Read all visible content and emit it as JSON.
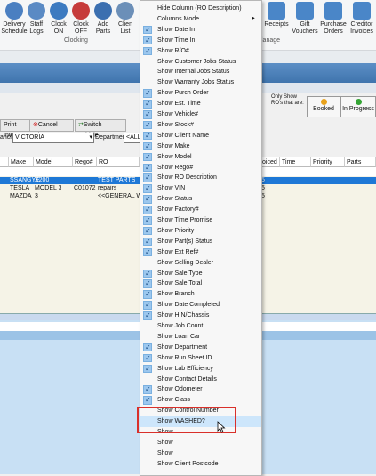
{
  "ribbon": {
    "buttons": [
      {
        "label": "Delivery\nSchedule",
        "icon": "calendar-icon",
        "color": "#4a7fc1"
      },
      {
        "label": "Staff\nLogs",
        "icon": "staff-logs-icon",
        "color": "#5a8ac4"
      },
      {
        "label": "Clock\nON",
        "icon": "clock-on-icon",
        "color": "#3c7ac0"
      },
      {
        "label": "Clock\nOFF",
        "icon": "clock-off-icon",
        "color": "#c63b3b"
      },
      {
        "label": "Add\nParts",
        "icon": "gear-add-icon",
        "color": "#3b6fb0"
      },
      {
        "label": "Clien\nList",
        "icon": "client-list-icon",
        "color": "#6b8fb8"
      }
    ],
    "right_buttons": [
      {
        "label": "Receipts",
        "icon": "receipts-icon"
      },
      {
        "label": "Gift\nVouchers",
        "icon": "gift-icon"
      },
      {
        "label": "Purchase\nOrders",
        "icon": "purchase-orders-icon"
      },
      {
        "label": "Creditor\nInvoices",
        "icon": "creditor-invoices-icon"
      }
    ],
    "group_clocking": "Clocking",
    "group_manage": "lanage"
  },
  "toolbar": {
    "print_invoice": "Print Inv...",
    "cancel_ro": "Cancel R/O",
    "switch_vehicle": "Switch Vehicle",
    "branch_label": "anch",
    "branch_value": "VICTORIA",
    "department_label": "Department",
    "department_value": "<ALL>",
    "only_show_text": "Only Show\nRO's that are:",
    "booked": "Booked",
    "in_progress": "In Progress"
  },
  "grid": {
    "left_headers": [
      "Make",
      "Model",
      "Rego#",
      "RO Description"
    ],
    "right_headers": [
      "oiced",
      "Time",
      "Priority",
      "Parts Status"
    ],
    "rows": [
      {
        "make": "SSANGYE",
        "model": "X200",
        "rego": "",
        "desc": "TEST PARTS",
        "right": "5",
        "selected": true
      },
      {
        "make": "TESLA",
        "model": "MODEL 3",
        "rego": "C01072",
        "desc": "repairs",
        "right": "5",
        "selected": false
      },
      {
        "make": "MAZDA",
        "model": "3",
        "rego": "",
        "desc": "<<GENERAL WO",
        "right": "5",
        "selected": false
      }
    ]
  },
  "menu": {
    "items": [
      {
        "label": "Hide Column (RO Description)",
        "checked": false
      },
      {
        "label": "Columns Mode",
        "checked": false,
        "submenu": true
      },
      {
        "label": "Show Date In",
        "checked": true
      },
      {
        "label": "Show Time In",
        "checked": true
      },
      {
        "label": "Show R/O#",
        "checked": true
      },
      {
        "label": "Show Customer Jobs Status",
        "checked": false
      },
      {
        "label": "Show Internal Jobs Status",
        "checked": false
      },
      {
        "label": "Show Warranty Jobs Status",
        "checked": false
      },
      {
        "label": "Show Purch Order",
        "checked": true
      },
      {
        "label": "Show Est. Time",
        "checked": true
      },
      {
        "label": "Show Vehicle#",
        "checked": true
      },
      {
        "label": "Show Stock#",
        "checked": true
      },
      {
        "label": "Show Client Name",
        "checked": true
      },
      {
        "label": "Show Make",
        "checked": true
      },
      {
        "label": "Show Model",
        "checked": true
      },
      {
        "label": "Show Rego#",
        "checked": true
      },
      {
        "label": "Show RO Description",
        "checked": true
      },
      {
        "label": "Show VIN",
        "checked": true
      },
      {
        "label": "Show Status",
        "checked": true
      },
      {
        "label": "Show Factory#",
        "checked": true
      },
      {
        "label": "Show Time Promise",
        "checked": true
      },
      {
        "label": "Show Priority",
        "checked": true
      },
      {
        "label": "Show Part(s) Status",
        "checked": true
      },
      {
        "label": "Show Ext Ref#",
        "checked": true
      },
      {
        "label": "Show Selling Dealer",
        "checked": false
      },
      {
        "label": "Show Sale Type",
        "checked": true
      },
      {
        "label": "Show Sale Total",
        "checked": true
      },
      {
        "label": "Show Branch",
        "checked": true
      },
      {
        "label": "Show Date Completed",
        "checked": true
      },
      {
        "label": "Show HIN/Chassis",
        "checked": true
      },
      {
        "label": "Show Job Count",
        "checked": false
      },
      {
        "label": "Show Loan Car",
        "checked": false
      },
      {
        "label": "Show Department",
        "checked": true
      },
      {
        "label": "Show Run Sheet ID",
        "checked": true
      },
      {
        "label": "Show Lab Efficiency",
        "checked": true
      },
      {
        "label": "Show Contact Details",
        "checked": false
      },
      {
        "label": "Show Odometer",
        "checked": true
      },
      {
        "label": "Show Class",
        "checked": true
      },
      {
        "label": "Show Control Number",
        "checked": false
      },
      {
        "label": "Show WASHED?",
        "checked": false,
        "hovered": true
      },
      {
        "label": "Show",
        "checked": false
      },
      {
        "label": "Show",
        "checked": false
      },
      {
        "label": "Show",
        "checked": false
      },
      {
        "label": "Show Client Postcode",
        "checked": false
      }
    ]
  },
  "colors": {
    "selection": "#1e78d6",
    "highlight_box": "#d9302a",
    "menu_hover": "#cde6fb"
  }
}
